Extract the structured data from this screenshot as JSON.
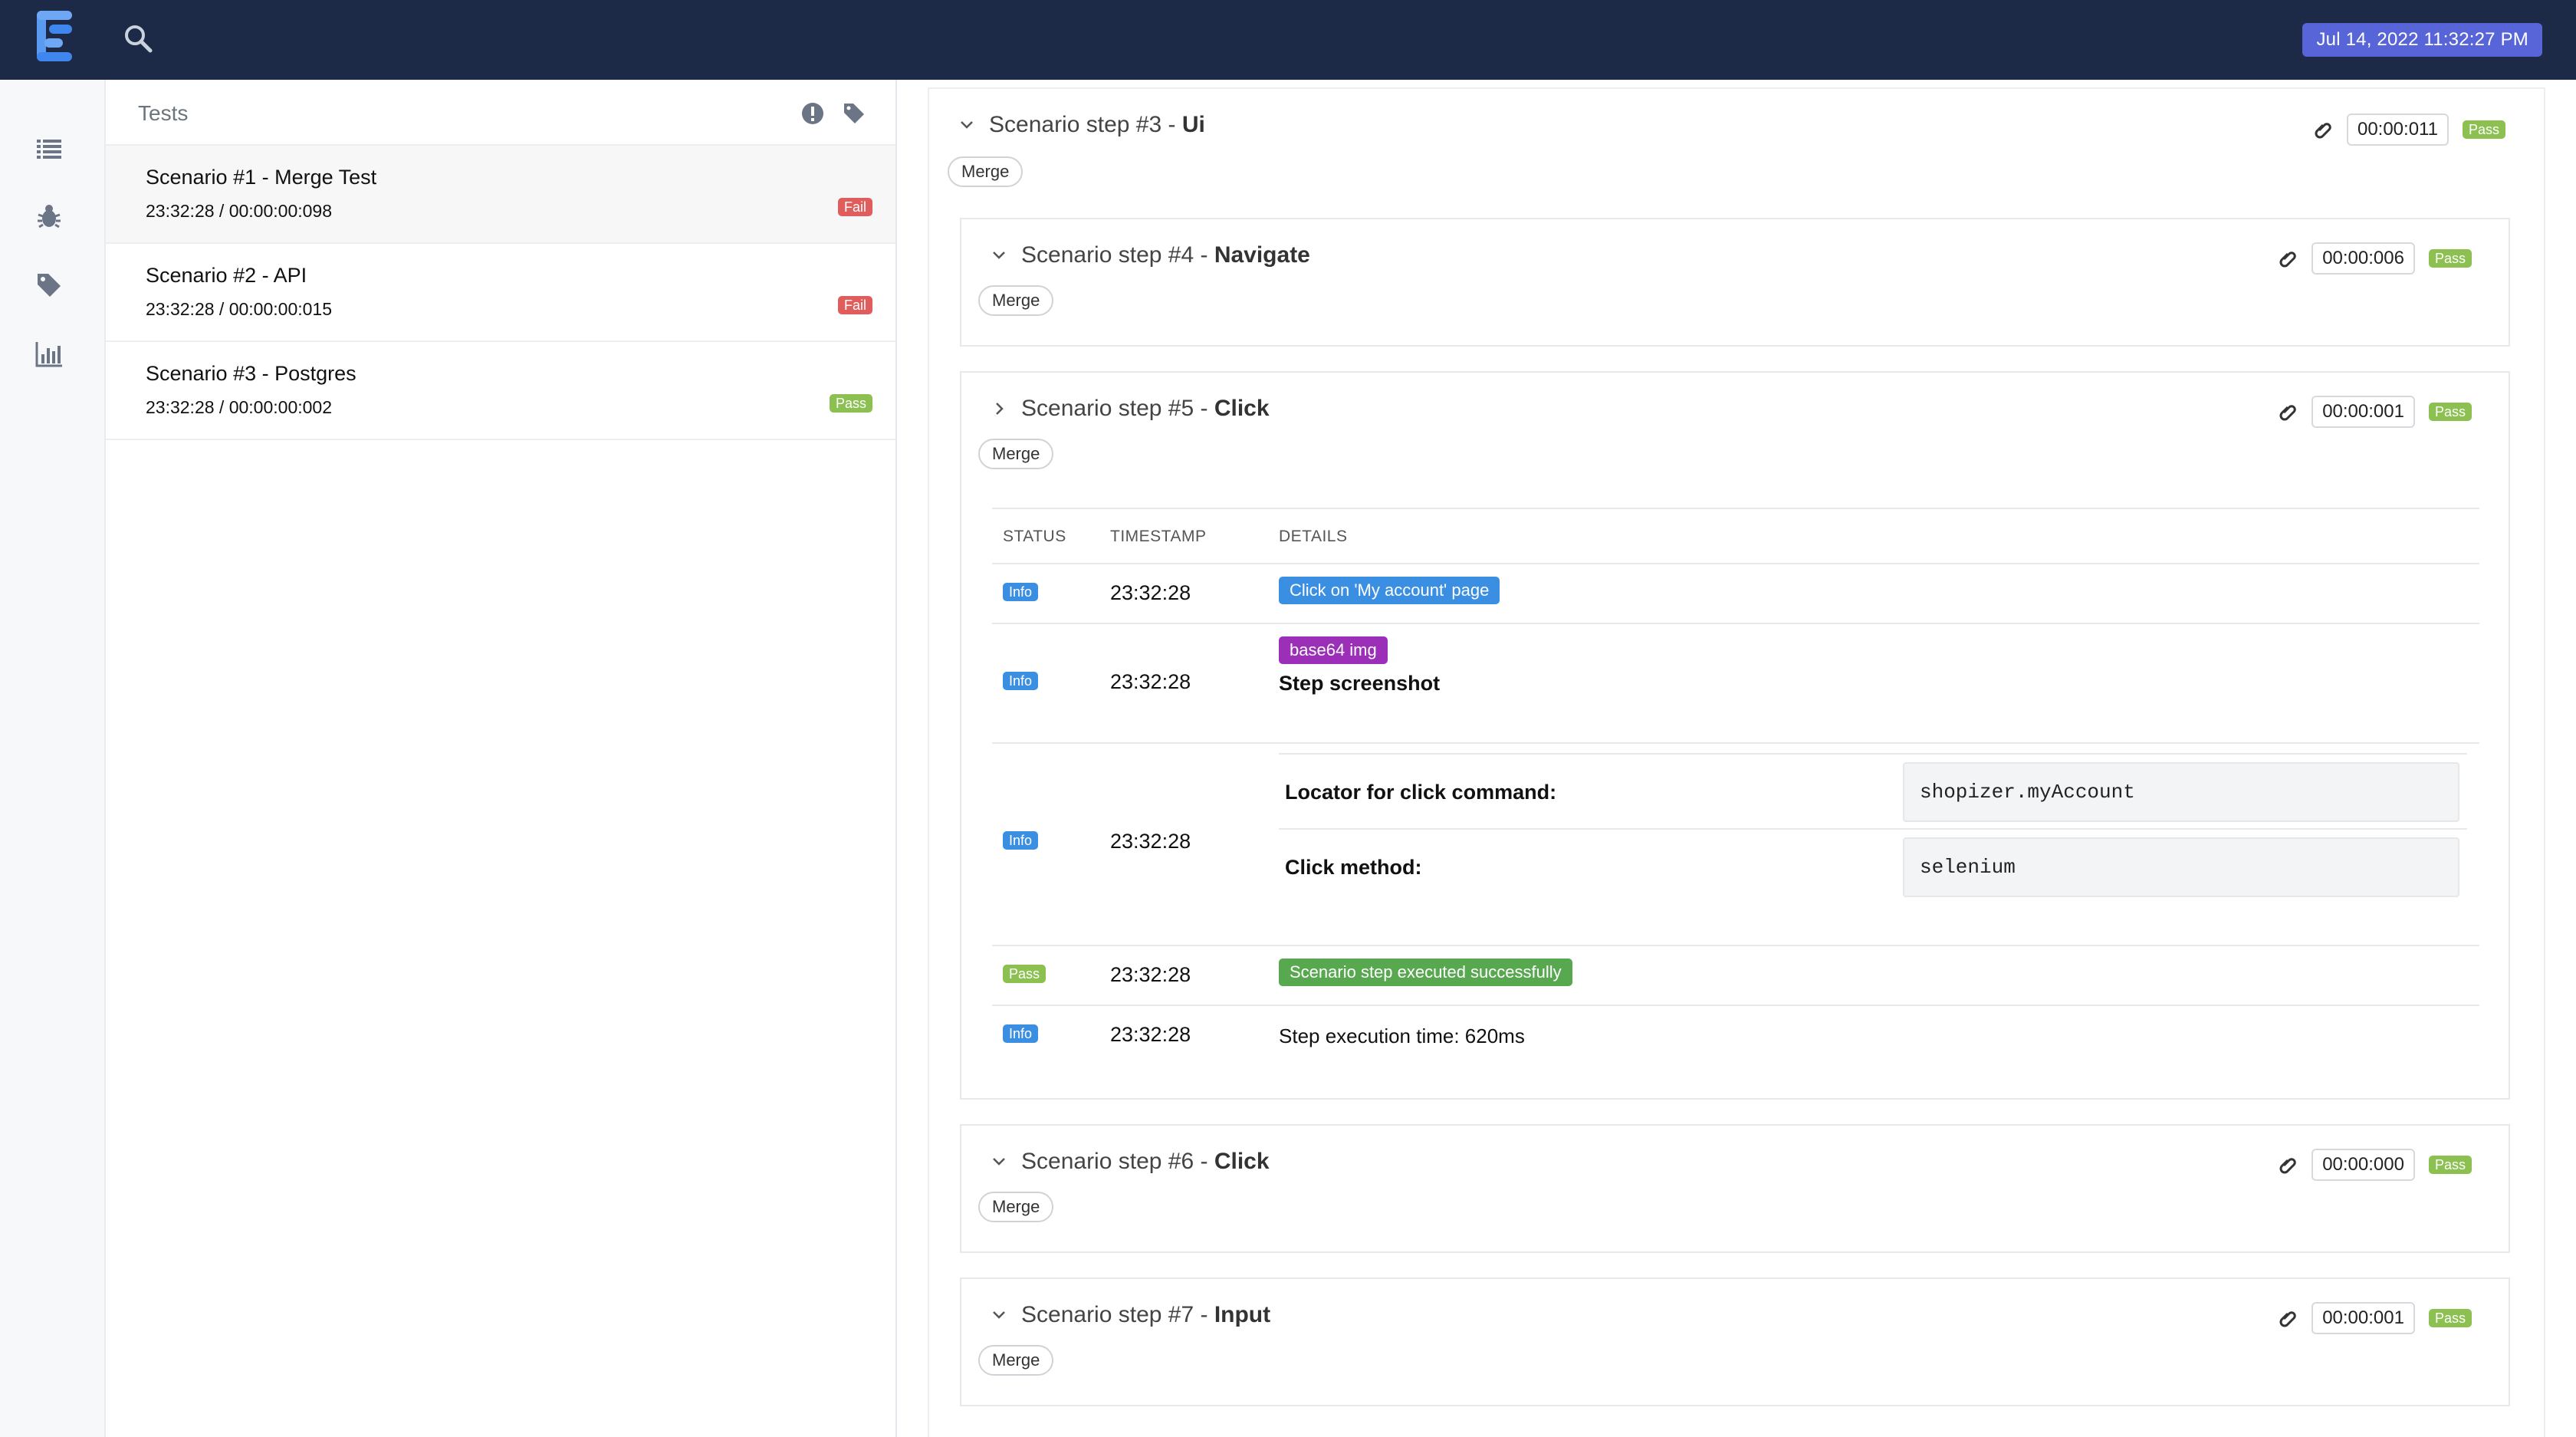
{
  "header": {
    "date_time": "Jul 14, 2022 11:32:27 PM"
  },
  "nav": {
    "icons": [
      "list-icon",
      "bug-icon",
      "tag-icon",
      "bar-chart-icon"
    ]
  },
  "tests_pane": {
    "title": "Tests",
    "items": [
      {
        "name": "Scenario #1 - Merge Test",
        "meta": "23:32:28 / 00:00:00:098",
        "status": "Fail"
      },
      {
        "name": "Scenario #2 - API",
        "meta": "23:32:28 / 00:00:00:015",
        "status": "Fail"
      },
      {
        "name": "Scenario #3 - Postgres",
        "meta": "23:32:28 / 00:00:00:002",
        "status": "Pass"
      }
    ]
  },
  "steps": {
    "s3": {
      "title": "Scenario step #3 - ",
      "bold": "Ui",
      "duration": "00:00:011",
      "status": "Pass",
      "tag": "Merge"
    },
    "s4": {
      "title": "Scenario step #4 - ",
      "bold": "Navigate",
      "duration": "00:00:006",
      "status": "Pass",
      "tag": "Merge"
    },
    "s5": {
      "title": "Scenario step #5 - ",
      "bold": "Click",
      "duration": "00:00:001",
      "status": "Pass",
      "tag": "Merge"
    },
    "s6": {
      "title": "Scenario step #6 - ",
      "bold": "Click",
      "duration": "00:00:000",
      "status": "Pass",
      "tag": "Merge"
    },
    "s7": {
      "title": "Scenario step #7 - ",
      "bold": "Input",
      "duration": "00:00:001",
      "status": "Pass",
      "tag": "Merge"
    }
  },
  "log": {
    "headers": {
      "status": "STATUS",
      "timestamp": "TIMESTAMP",
      "details": "DETAILS"
    },
    "rows": [
      {
        "status": "Info",
        "timestamp": "23:32:28",
        "details": "Click on 'My account' page"
      },
      {
        "status": "Info",
        "timestamp": "23:32:28",
        "badge": "base64 img",
        "details": "Step screenshot"
      },
      {
        "status": "Info",
        "timestamp": "23:32:28",
        "locator_label": "Locator for click command:",
        "locator_value": "shopizer.myAccount",
        "method_label": "Click method:",
        "method_value": "selenium"
      },
      {
        "status": "Pass",
        "timestamp": "23:32:28",
        "details": "Scenario step executed successfully"
      },
      {
        "status": "Info",
        "timestamp": "23:32:28",
        "details": "Step execution time: 620ms"
      }
    ]
  }
}
